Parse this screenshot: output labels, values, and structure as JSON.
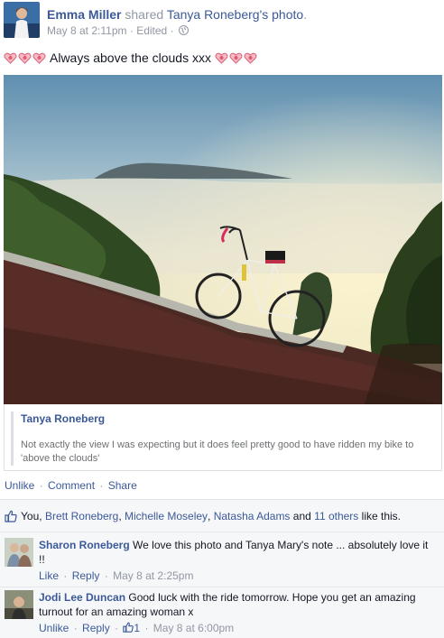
{
  "post": {
    "author": "Emma Miller",
    "shared_word": "shared",
    "shared_owner": "Tanya Roneberg's",
    "shared_object": "photo",
    "period": ".",
    "timestamp": "May 8 at 2:11pm",
    "edited": "Edited",
    "privacy_icon": "globe-icon",
    "status_text": "Always above the clouds xxx",
    "heart_icon": "heart-emoji-icon"
  },
  "note": {
    "author": "Tanya Roneberg",
    "text": "Not exactly the view I was expecting but it does feel pretty good to have ridden my bike to 'above the clouds'"
  },
  "actions": {
    "unlike": "Unlike",
    "comment": "Comment",
    "share": "Share",
    "separator": "·"
  },
  "likes": {
    "you": "You,",
    "names": [
      "Brett Roneberg",
      "Michelle Moseley",
      "Natasha Adams"
    ],
    "and": "and",
    "others": "11 others",
    "suffix": "like this."
  },
  "comments": [
    {
      "name": "Sharon Roneberg",
      "text": "We love this photo and Tanya Mary's note ... absolutely love it !!",
      "action1": "Like",
      "action2": "Reply",
      "time": "May 8 at 2:25pm"
    },
    {
      "name": "Jodi Lee Duncan",
      "text": "Good luck with the ride tomorrow. Hope you get an amazing turnout for an amazing woman x",
      "action1": "Unlike",
      "action2": "Reply",
      "like_count": "1",
      "time": "May 8 at 6:00pm"
    }
  ],
  "colors": {
    "link": "#3b5998",
    "muted": "#9197a3",
    "ufi_bg": "#f6f7f9"
  }
}
